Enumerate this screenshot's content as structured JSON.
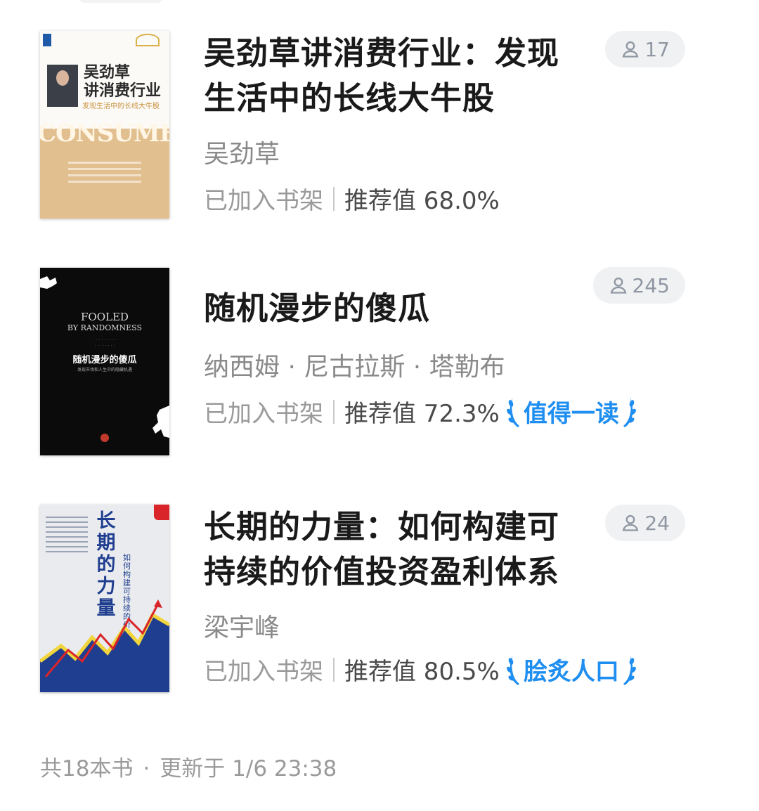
{
  "books": [
    {
      "title_lines": [
        "吴劲草讲消费行业：发现",
        "生活中的长线大牛股"
      ],
      "author": "吴劲草",
      "shelf_status": "已加入书架",
      "recommend": "推荐值 68.0%",
      "readers": "17",
      "badge": "",
      "cover": {
        "title_lines": [
          "吴劲草",
          "讲消费行业"
        ],
        "subtitle": "发现生活中的长线大牛股",
        "word": "CONSUMER"
      }
    },
    {
      "title_lines": [
        "随机漫步的傻瓜"
      ],
      "author": "纳西姆 · 尼古拉斯 · 塔勒布",
      "shelf_status": "已加入书架",
      "recommend": "推荐值 72.3%",
      "readers": "245",
      "badge": "值得一读",
      "cover": {
        "en_lines": [
          "FOOLED",
          "BY RANDOMNESS"
        ],
        "title": "随机漫步的傻瓜",
        "subtitle": "发现市场和人生中的隐藏机遇"
      }
    },
    {
      "title_lines": [
        "长期的力量：如何构建可",
        "持续的价值投资盈利体系"
      ],
      "author": "梁宇峰",
      "shelf_status": "已加入书架",
      "recommend": "推荐值 80.5%",
      "readers": "24",
      "badge": "脍炙人口",
      "cover": {
        "title": "长期的力量",
        "subtitle": "如何构建可持续的价值投资盈利体系"
      }
    }
  ],
  "footer": {
    "count": "共18本书",
    "updated": "更新于 1/6 23:38"
  },
  "colors": {
    "badge": "#1f8ef1",
    "pill_bg": "#f0f1f3",
    "muted": "#9a9a9a"
  },
  "icons": {
    "readers": "person-icon",
    "badge": "laurel-icon"
  }
}
